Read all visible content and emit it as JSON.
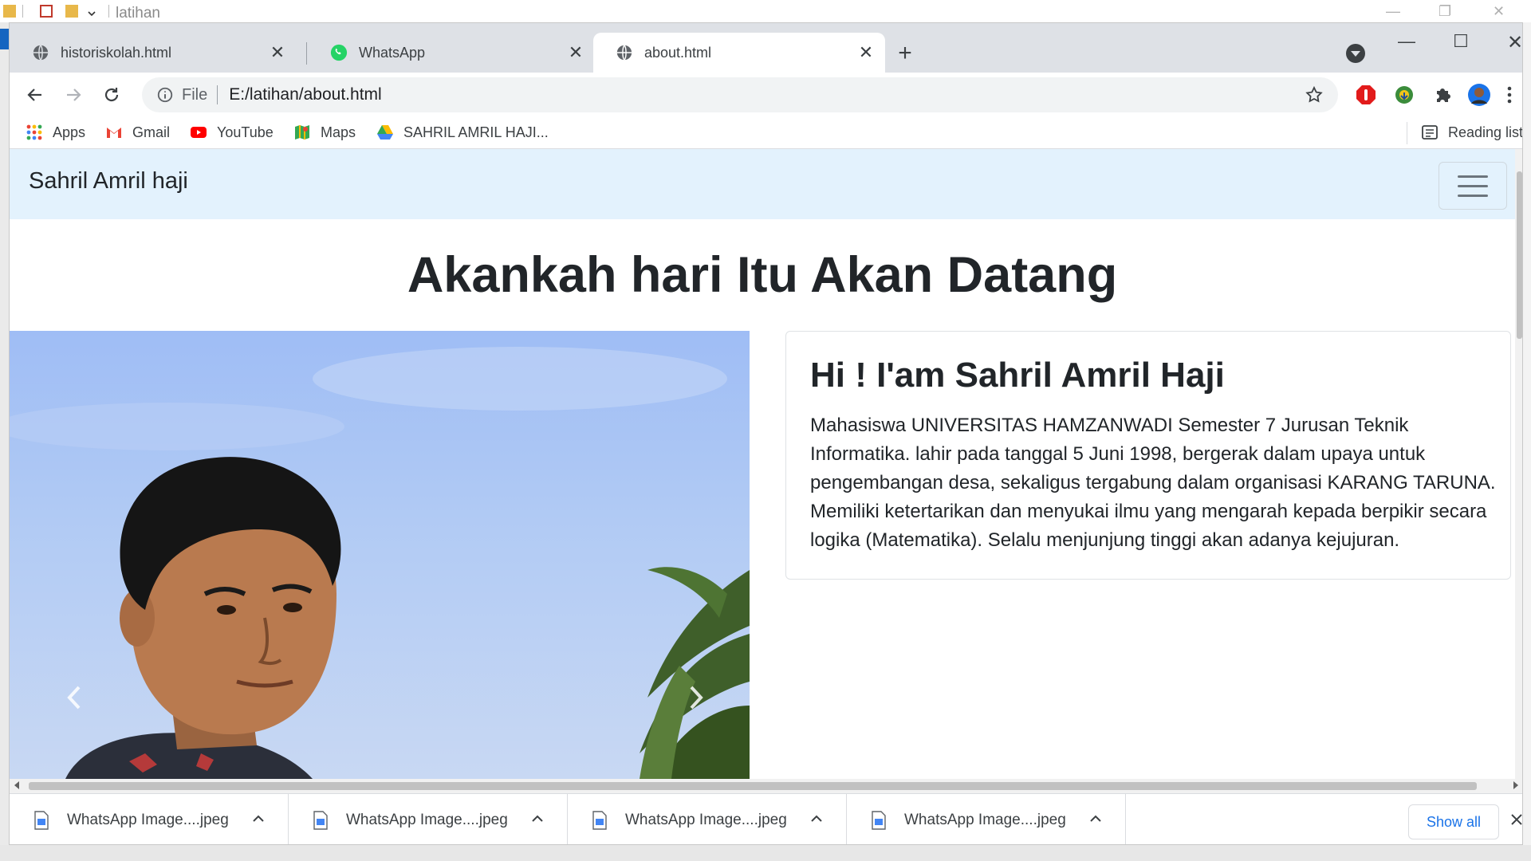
{
  "explorer": {
    "title": "latihan"
  },
  "tabs": [
    {
      "label": "historiskolah.html",
      "icon": "globe-icon",
      "close": "✕"
    },
    {
      "label": "WhatsApp",
      "icon": "whatsapp-icon",
      "close": "✕"
    },
    {
      "label": "about.html",
      "icon": "globe-icon",
      "close": "✕",
      "active": true
    }
  ],
  "toolbar": {
    "file_label": "File",
    "url": "E:/latihan/about.html"
  },
  "bookmarks": [
    {
      "label": "Apps",
      "icon": "apps-grid-icon"
    },
    {
      "label": "Gmail",
      "icon": "gmail-icon"
    },
    {
      "label": "YouTube",
      "icon": "youtube-icon"
    },
    {
      "label": "Maps",
      "icon": "maps-icon"
    },
    {
      "label": "SAHRIL AMRIL HAJI...",
      "icon": "drive-icon"
    }
  ],
  "reading_list": "Reading list",
  "page": {
    "brand": "Sahril Amril haji",
    "hero_title": "Akankah hari Itu Akan Datang",
    "card_title": "Hi ! I'am Sahril Amril Haji",
    "card_text": "Mahasiswa UNIVERSITAS HAMZANWADI Semester 7 Jurusan Teknik Informatika. lahir pada tanggal 5 Juni 1998, bergerak dalam upaya untuk pengembangan desa, sekaligus tergabung dalam organisasi KARANG TARUNA. Memiliki ketertarikan dan menyukai ilmu yang mengarah kepada berpikir secara logika (Matematika). Selalu menjunjung tinggi akan adanya kejujuran."
  },
  "downloads": {
    "items": [
      {
        "name": "WhatsApp Image....jpeg"
      },
      {
        "name": "WhatsApp Image....jpeg"
      },
      {
        "name": "WhatsApp Image....jpeg"
      },
      {
        "name": "WhatsApp Image....jpeg"
      }
    ],
    "show_all": "Show all"
  },
  "colors": {
    "tabstrip": "#dee1e6",
    "navbar": "#e3f2fd",
    "link_blue": "#1a73e8",
    "sky": "#a9c4f4"
  }
}
